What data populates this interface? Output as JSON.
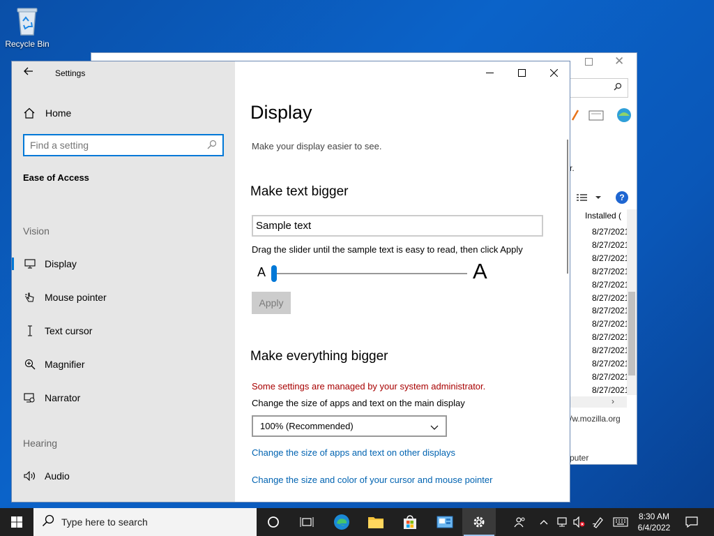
{
  "desktop": {
    "recycle_bin_label": "Recycle Bin"
  },
  "background_window": {
    "partial_text": "r.",
    "column_header": "Installed (",
    "dates": [
      "8/27/2021",
      "8/27/2021",
      "8/27/2021",
      "8/27/2021",
      "8/27/2021",
      "8/27/2021",
      "8/27/2021",
      "8/27/2021",
      "8/27/2021",
      "8/27/2021",
      "8/27/2021",
      "8/27/2021",
      "8/27/2021"
    ],
    "url_text": "/w.mozilla.org",
    "computer_text": "puter"
  },
  "settings": {
    "window_title": "Settings",
    "sidebar": {
      "home_label": "Home",
      "search_placeholder": "Find a setting",
      "section_title": "Ease of Access",
      "vision_label": "Vision",
      "items": [
        {
          "label": "Display",
          "icon": "monitor-icon"
        },
        {
          "label": "Mouse pointer",
          "icon": "mouse-pointer-icon"
        },
        {
          "label": "Text cursor",
          "icon": "text-cursor-icon"
        },
        {
          "label": "Magnifier",
          "icon": "magnifier-icon"
        },
        {
          "label": "Narrator",
          "icon": "narrator-icon"
        }
      ],
      "hearing_label": "Hearing",
      "hearing_items": [
        {
          "label": "Audio",
          "icon": "speaker-icon"
        }
      ]
    },
    "main": {
      "title": "Display",
      "subtitle": "Make your display easier to see.",
      "text_bigger_heading": "Make text bigger",
      "sample_text": "Sample text",
      "slider_instruction": "Drag the slider until the sample text is easy to read, then click Apply",
      "slider_small_label": "A",
      "slider_large_label": "A",
      "slider_value": 0.0,
      "apply_label": "Apply",
      "everything_bigger_heading": "Make everything bigger",
      "admin_warning": "Some settings are managed by your system administrator.",
      "scale_label": "Change the size of apps and text on the main display",
      "scale_selected": "100% (Recommended)",
      "link_other_displays": "Change the size of apps and text on other displays",
      "link_cursor": "Change the size and color of your cursor and mouse pointer"
    }
  },
  "taskbar": {
    "search_placeholder": "Type here to search",
    "time": "8:30 AM",
    "date": "6/4/2022",
    "accent": "#0078d7"
  }
}
